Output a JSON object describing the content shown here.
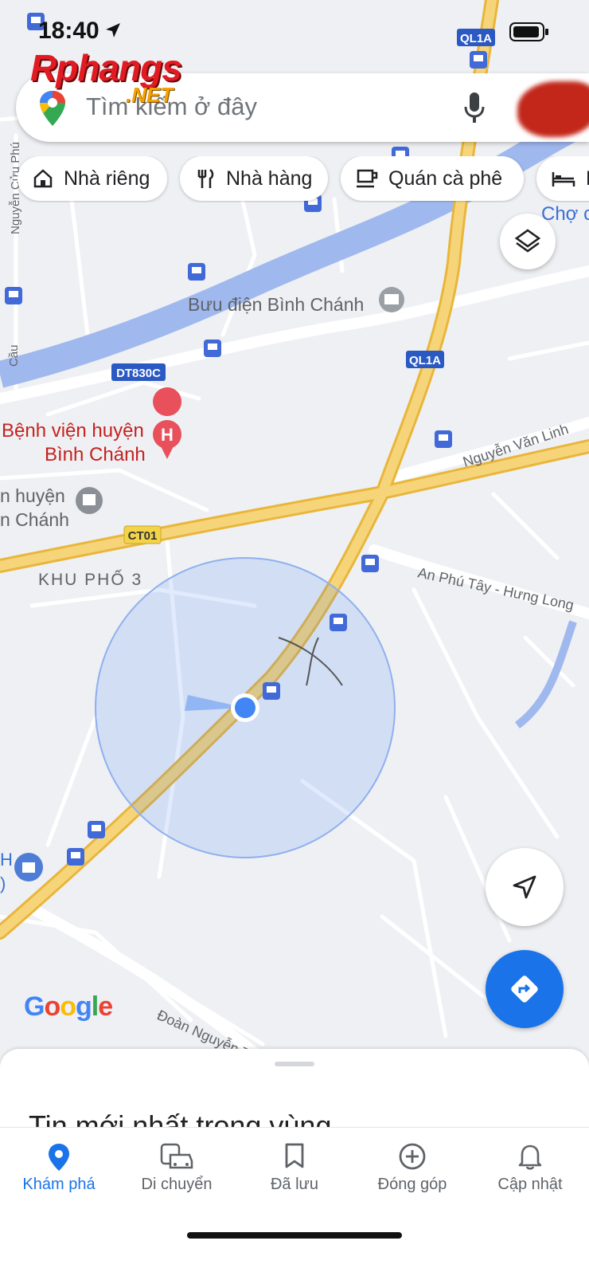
{
  "status_bar": {
    "time": "18:40"
  },
  "watermark": {
    "brand": "Rphangs",
    "suffix": ".NET"
  },
  "search": {
    "placeholder": "Tìm kiếm ở đây"
  },
  "chips": [
    {
      "label": "Nhà riêng",
      "icon": "home-icon"
    },
    {
      "label": "Nhà hàng",
      "icon": "restaurant-icon"
    },
    {
      "label": "Quán cà phê",
      "icon": "coffee-icon"
    },
    {
      "label": "K",
      "icon": "hotel-icon"
    }
  ],
  "map": {
    "labels": {
      "cho": "Chợ c",
      "buu_dien": "Bưu điện Bình Chánh",
      "benh_vien_1": "Bệnh viện huyện",
      "benh_vien_2": "Bình Chánh",
      "huyen_1": "n huyện",
      "huyen_2": "n Chánh",
      "khu_pho": "KHU PHỐ 3",
      "nguyen_van_linh": "Nguyễn Văn Linh",
      "an_phu_tay": "An Phú Tây - Hưng Long",
      "doan_nguyen": "Đoàn Nguyễn T",
      "nguyen_cuu": "Nguyễn Cửu Phú",
      "cau": "Cầu",
      "edge_h": "H",
      "edge_paren": ")"
    },
    "shields": {
      "ql1a": "QL1A",
      "dt830c": "DT830C",
      "ct01": "CT01"
    },
    "google_logo": "Google",
    "colors": {
      "accent": "#1a73e8",
      "water": "#9fb8ee",
      "highway": "#f3c85a",
      "poi_red": "#d93025",
      "location_dot": "#4285f4"
    }
  },
  "bottom_sheet": {
    "title": "Tin mới nhất trong vùng"
  },
  "nav": [
    {
      "label": "Khám phá",
      "icon": "explore-pin-icon",
      "active": true
    },
    {
      "label": "Di chuyển",
      "icon": "car-bus-icon",
      "active": false
    },
    {
      "label": "Đã lưu",
      "icon": "bookmark-icon",
      "active": false
    },
    {
      "label": "Đóng góp",
      "icon": "add-circle-icon",
      "active": false
    },
    {
      "label": "Cập nhật",
      "icon": "bell-icon",
      "active": false
    }
  ]
}
